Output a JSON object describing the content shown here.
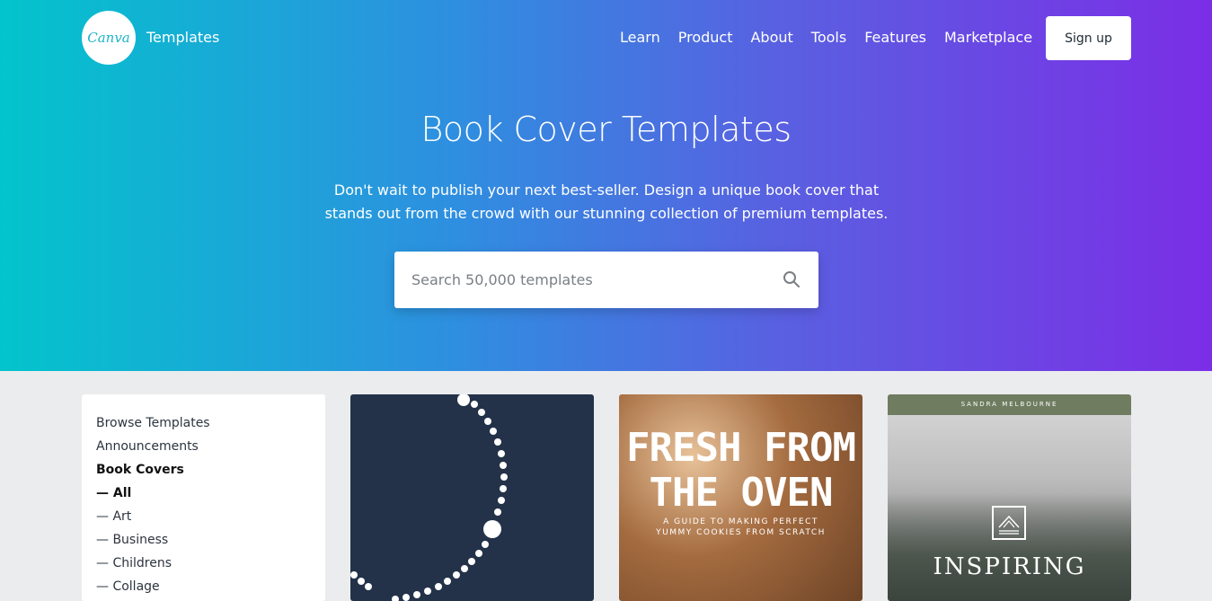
{
  "header": {
    "logo_text": "Canva",
    "brand_sub": "Templates",
    "nav": [
      "Learn",
      "Product",
      "About",
      "Tools",
      "Features",
      "Marketplace"
    ],
    "signup_label": "Sign up"
  },
  "hero": {
    "title": "Book Cover Templates",
    "subtitle_line1": "Don't wait to publish your next best-seller. Design a unique book cover that",
    "subtitle_line2": "stands out from the crowd with our stunning collection of premium templates.",
    "search_placeholder": "Search 50,000 templates"
  },
  "sidebar": {
    "items": [
      {
        "label": "Browse Templates"
      },
      {
        "label": "Announcements"
      },
      {
        "label": "Book Covers"
      },
      {
        "label": "— All"
      },
      {
        "label": "— Art"
      },
      {
        "label": "— Business"
      },
      {
        "label": "— Childrens"
      },
      {
        "label": "— Collage"
      }
    ]
  },
  "cards": [
    {
      "name": "pearls"
    },
    {
      "headline1": "FRESH FROM",
      "headline2": "THE OVEN",
      "sub1": "A GUIDE TO MAKING PERFECT",
      "sub2": "YUMMY COOKIES FROM SCRATCH"
    },
    {
      "author": "SANDRA MELBOURNE",
      "headline": "INSPIRING"
    }
  ],
  "colors": {
    "gradient_start": "#03c4cc",
    "gradient_end": "#7b2ee6",
    "card1_bg": "#233249"
  }
}
